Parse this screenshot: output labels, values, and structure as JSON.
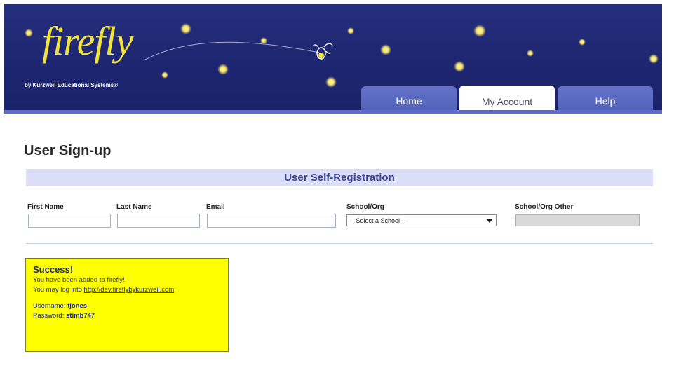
{
  "header": {
    "logo_text": "firefly",
    "logo_subtitle": "by Kurzweil Educational Systems®"
  },
  "nav": {
    "tabs": [
      {
        "label": "Home",
        "active": false
      },
      {
        "label": "My Account",
        "active": true
      },
      {
        "label": "Help",
        "active": false
      }
    ]
  },
  "page": {
    "title": "User Sign-up",
    "section_title": "User Self-Registration"
  },
  "form": {
    "first_name_label": "First Name",
    "first_name_value": "",
    "last_name_label": "Last Name",
    "last_name_value": "",
    "email_label": "Email",
    "email_value": "",
    "school_label": "School/Org",
    "school_selected": "-- Select a School --",
    "school_other_label": "School/Org Other",
    "school_other_value": ""
  },
  "success": {
    "heading": "Success!",
    "line1": "You have been added to firefly!",
    "line2_prefix": "You may log into ",
    "link_text": "http://dev.fireflybykurzweil.com",
    "line2_suffix": ".",
    "username_label": "Username: ",
    "username_value": "fjones",
    "password_label": "Password: ",
    "password_value": "stimb747"
  },
  "colors": {
    "header_bg": "#1d2570",
    "tab_bg": "#5a6bc0",
    "section_bar": "#dcdef7",
    "success_bg": "#ffff00",
    "success_text": "#1b2a8f",
    "logo_yellow": "#f1e23d"
  }
}
